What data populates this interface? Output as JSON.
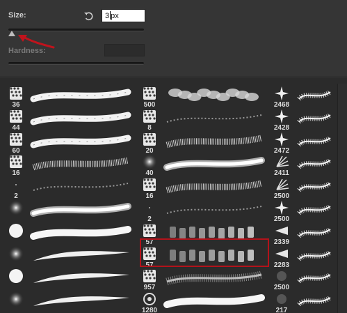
{
  "controls": {
    "size_label": "Size:",
    "size_value": "3",
    "size_unit": "px",
    "size_fraction": 0.0,
    "hardness_label": "Hardness:",
    "hardness_value": ""
  },
  "columns": [
    {
      "brushes": [
        {
          "size": "36",
          "tip": "texture",
          "stroke": "rough"
        },
        {
          "size": "44",
          "tip": "texture",
          "stroke": "rough"
        },
        {
          "size": "60",
          "tip": "texture",
          "stroke": "rough"
        },
        {
          "size": "16",
          "tip": "texture",
          "stroke": "chalk"
        },
        {
          "size": "2",
          "tip": "dot",
          "stroke": "dry"
        },
        {
          "size": "",
          "tip": "soft",
          "stroke": "soft"
        },
        {
          "size": "",
          "tip": "hard",
          "stroke": "hard"
        },
        {
          "size": "",
          "tip": "soft",
          "stroke": "taper"
        },
        {
          "size": "",
          "tip": "hard",
          "stroke": "taper"
        },
        {
          "size": "",
          "tip": "soft",
          "stroke": "taper"
        }
      ]
    },
    {
      "brushes": [
        {
          "size": "500",
          "tip": "texture",
          "stroke": "cloud"
        },
        {
          "size": "8",
          "tip": "texture",
          "stroke": "dry"
        },
        {
          "size": "20",
          "tip": "texture",
          "stroke": "chalk"
        },
        {
          "size": "40",
          "tip": "soft",
          "stroke": "soft"
        },
        {
          "size": "16",
          "tip": "texture",
          "stroke": "chalk"
        },
        {
          "size": "2",
          "tip": "dot",
          "stroke": "dry"
        },
        {
          "size": "57",
          "tip": "texture",
          "stroke": "dabs"
        },
        {
          "size": "57",
          "tip": "texture",
          "stroke": "dabs"
        },
        {
          "size": "957",
          "tip": "texture",
          "stroke": "fuzzy"
        },
        {
          "size": "1280",
          "tip": "ring",
          "stroke": "hard"
        }
      ]
    },
    {
      "brushes": [
        {
          "size": "2468",
          "tip": "star",
          "stroke": "spiky"
        },
        {
          "size": "2428",
          "tip": "star",
          "stroke": "spiky"
        },
        {
          "size": "2472",
          "tip": "star",
          "stroke": "spiky"
        },
        {
          "size": "2411",
          "tip": "fan",
          "stroke": "spiky"
        },
        {
          "size": "2500",
          "tip": "fan",
          "stroke": "spiky"
        },
        {
          "size": "2500",
          "tip": "star",
          "stroke": "spiky"
        },
        {
          "size": "2339",
          "tip": "wedge",
          "stroke": "spiky"
        },
        {
          "size": "2283",
          "tip": "wedge",
          "stroke": "spiky"
        },
        {
          "size": "2500",
          "tip": "dark",
          "stroke": "spiky"
        },
        {
          "size": "217",
          "tip": "dark",
          "stroke": "spiky"
        }
      ]
    }
  ],
  "colors": {
    "highlight": "#b3121a",
    "arrow": "#c0131c"
  }
}
